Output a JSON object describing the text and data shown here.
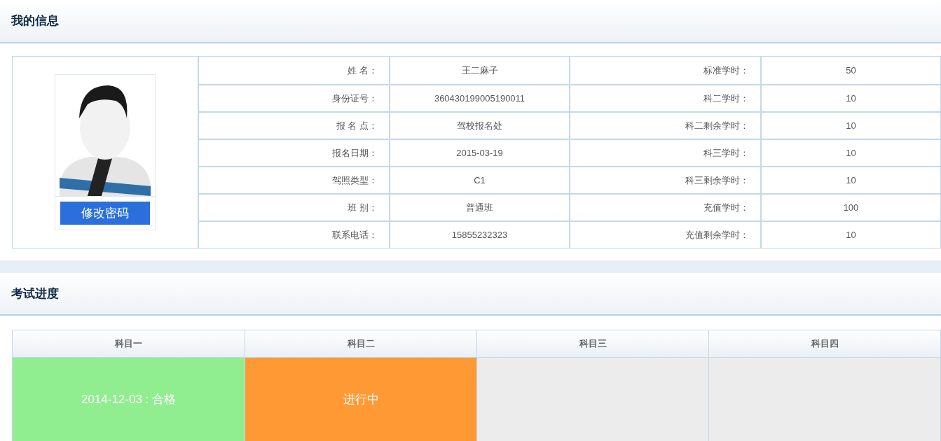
{
  "profile": {
    "title": "我的信息",
    "change_password_button": "修改密码",
    "rows": [
      {
        "label": "姓 名：",
        "value": "王二麻子",
        "label2": "标准学时：",
        "value2": "50"
      },
      {
        "label": "身份证号：",
        "value": "360430199005190011",
        "label2": "科二学时：",
        "value2": "10"
      },
      {
        "label": "报 名 点：",
        "value": "驾校报名处",
        "label2": "科二剩余学时：",
        "value2": "10"
      },
      {
        "label": "报名日期：",
        "value": "2015-03-19",
        "label2": "科三学时：",
        "value2": "10"
      },
      {
        "label": "驾照类型：",
        "value": "C1",
        "label2": "科三剩余学时：",
        "value2": "10"
      },
      {
        "label": "班 别：",
        "value": "普通班",
        "label2": "充值学时：",
        "value2": "100"
      },
      {
        "label": "联系电话：",
        "value": "15855232323",
        "label2": "充值剩余学时：",
        "value2": "10"
      }
    ]
  },
  "progress": {
    "title": "考试进度",
    "subjects": [
      {
        "name": "科目一",
        "color": "#90ee90",
        "text": "2014-12-03 : 合格"
      },
      {
        "name": "科目二",
        "color": "#ff9933",
        "text": "进行中"
      },
      {
        "name": "科目三",
        "color": "#ececec"
      },
      {
        "name": "科目四",
        "color": "#ececec"
      }
    ]
  }
}
